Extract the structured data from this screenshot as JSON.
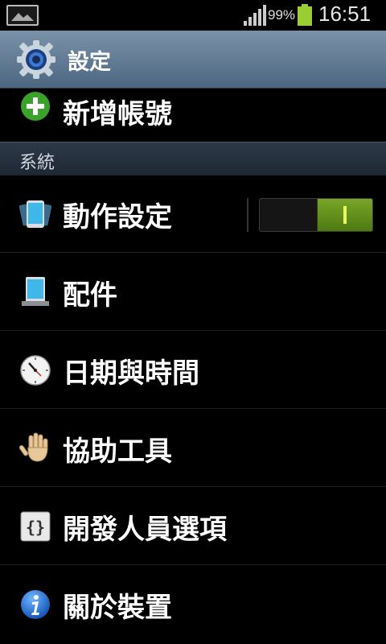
{
  "status_bar": {
    "battery_percent": "99%",
    "time": "16:51",
    "icons": [
      "gallery-icon",
      "signal-icon",
      "battery-icon"
    ]
  },
  "title_bar": {
    "title": "設定",
    "icon": "settings-gear-icon"
  },
  "partial_item": {
    "label": "新增帳號",
    "icon": "add-icon"
  },
  "section": {
    "label": "系統"
  },
  "items": [
    {
      "label": "動作設定",
      "icon": "motion-icon",
      "toggle": "on"
    },
    {
      "label": "配件",
      "icon": "accessory-icon"
    },
    {
      "label": "日期與時間",
      "icon": "clock-icon"
    },
    {
      "label": "協助工具",
      "icon": "hand-icon"
    },
    {
      "label": "開發人員選項",
      "icon": "braces-icon"
    },
    {
      "label": "關於裝置",
      "icon": "info-icon"
    }
  ],
  "colors": {
    "accent_green": "#5e8c18",
    "title_bar": "#5f7890"
  }
}
